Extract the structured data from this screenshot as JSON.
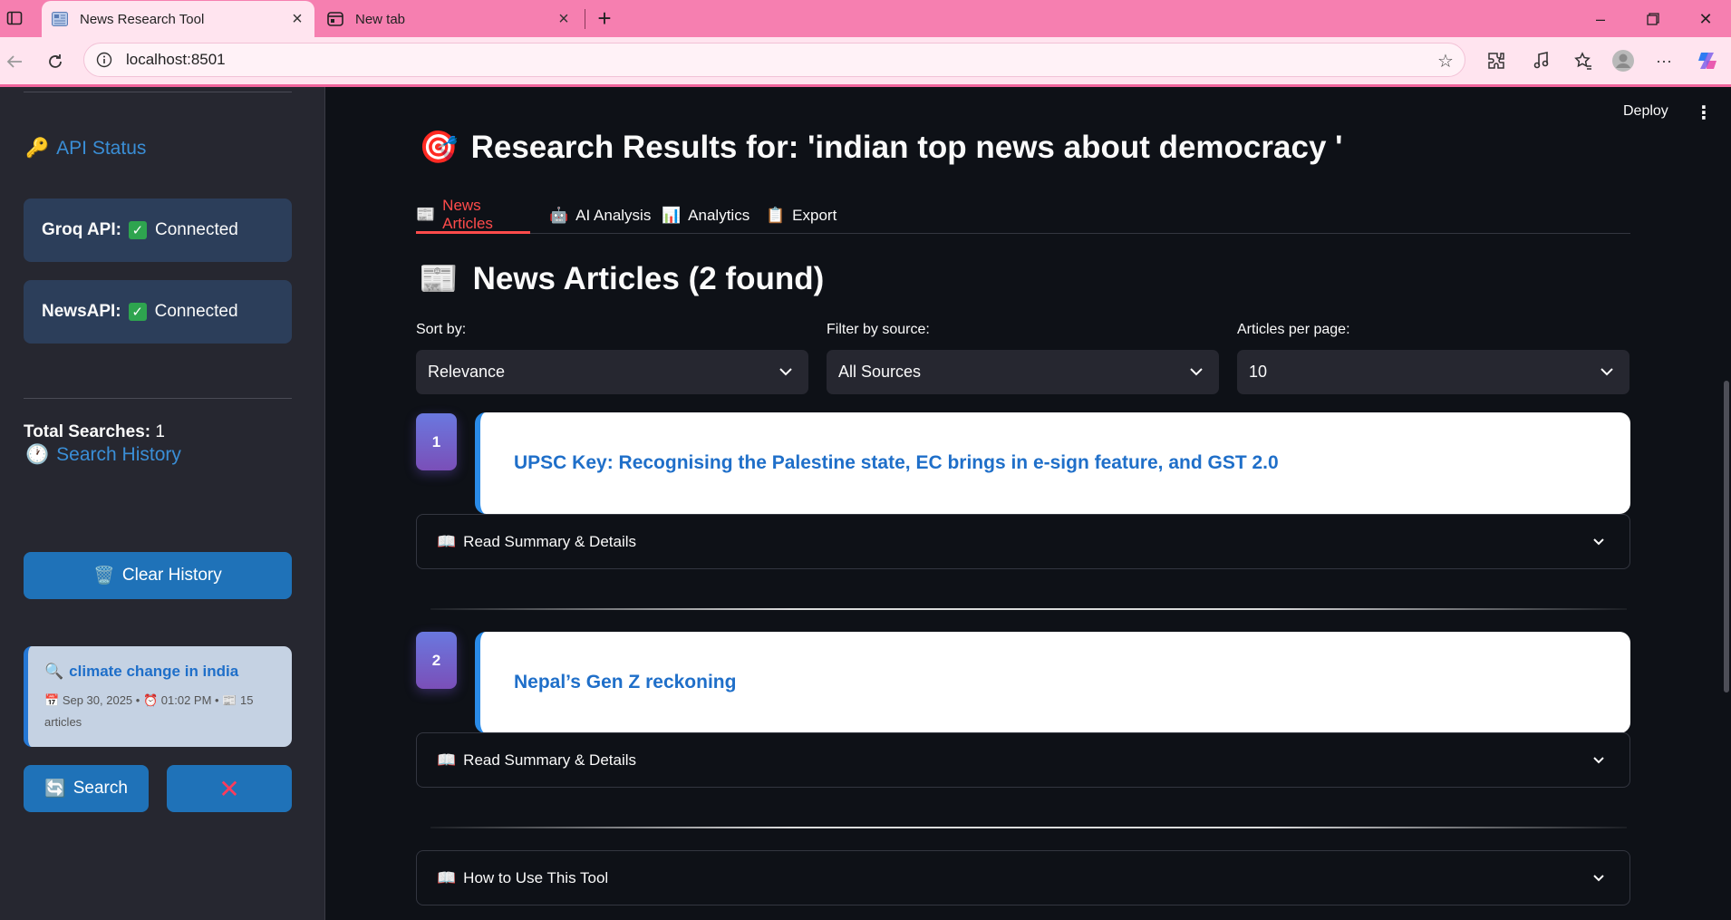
{
  "browser": {
    "tabs": [
      {
        "title": "News Research Tool"
      },
      {
        "title": "New tab"
      }
    ],
    "url": "localhost:8501"
  },
  "sidebar": {
    "api_status_title": "API Status",
    "api_cards": [
      {
        "name": "Groq API:",
        "status": "Connected"
      },
      {
        "name": "NewsAPI:",
        "status": "Connected"
      }
    ],
    "search_history_title": "Search History",
    "total_label": "Total Searches:",
    "total_value": "1",
    "clear_label": "Clear History",
    "history": [
      {
        "query": "climate change in india",
        "date": "Sep 30, 2025 •",
        "time": "01:02 PM •",
        "count": "15 articles"
      }
    ],
    "search_label": "Search",
    "delete_label": "✕"
  },
  "header": {
    "deploy_label": "Deploy"
  },
  "main": {
    "title": "Research Results for: 'indian top news about democracy '",
    "tabs": [
      {
        "label": "News Articles",
        "active": true
      },
      {
        "label": "AI Analysis",
        "active": false
      },
      {
        "label": "Analytics",
        "active": false
      },
      {
        "label": "Export",
        "active": false
      }
    ],
    "section_title": "News Articles (2 found)",
    "filters": {
      "sort_label": "Sort by:",
      "sort_value": "Relevance",
      "source_label": "Filter by source:",
      "source_value": "All Sources",
      "per_page_label": "Articles per page:",
      "per_page_value": "10"
    },
    "articles": [
      {
        "num": "1",
        "title": "UPSC Key: Recognising the Palestine state, EC brings in e-sign feature, and GST 2.0",
        "expander": "Read Summary & Details"
      },
      {
        "num": "2",
        "title": "Nepal’s Gen Z reckoning",
        "expander": "Read Summary & Details"
      }
    ],
    "howto_label": "How to Use This Tool"
  },
  "colors": {
    "accent_red": "#ff4b4b",
    "link_blue": "#1f6fc9",
    "sidebar_bg": "#262730",
    "main_bg": "#0e1117",
    "browser_pink": "#f67fb0"
  }
}
